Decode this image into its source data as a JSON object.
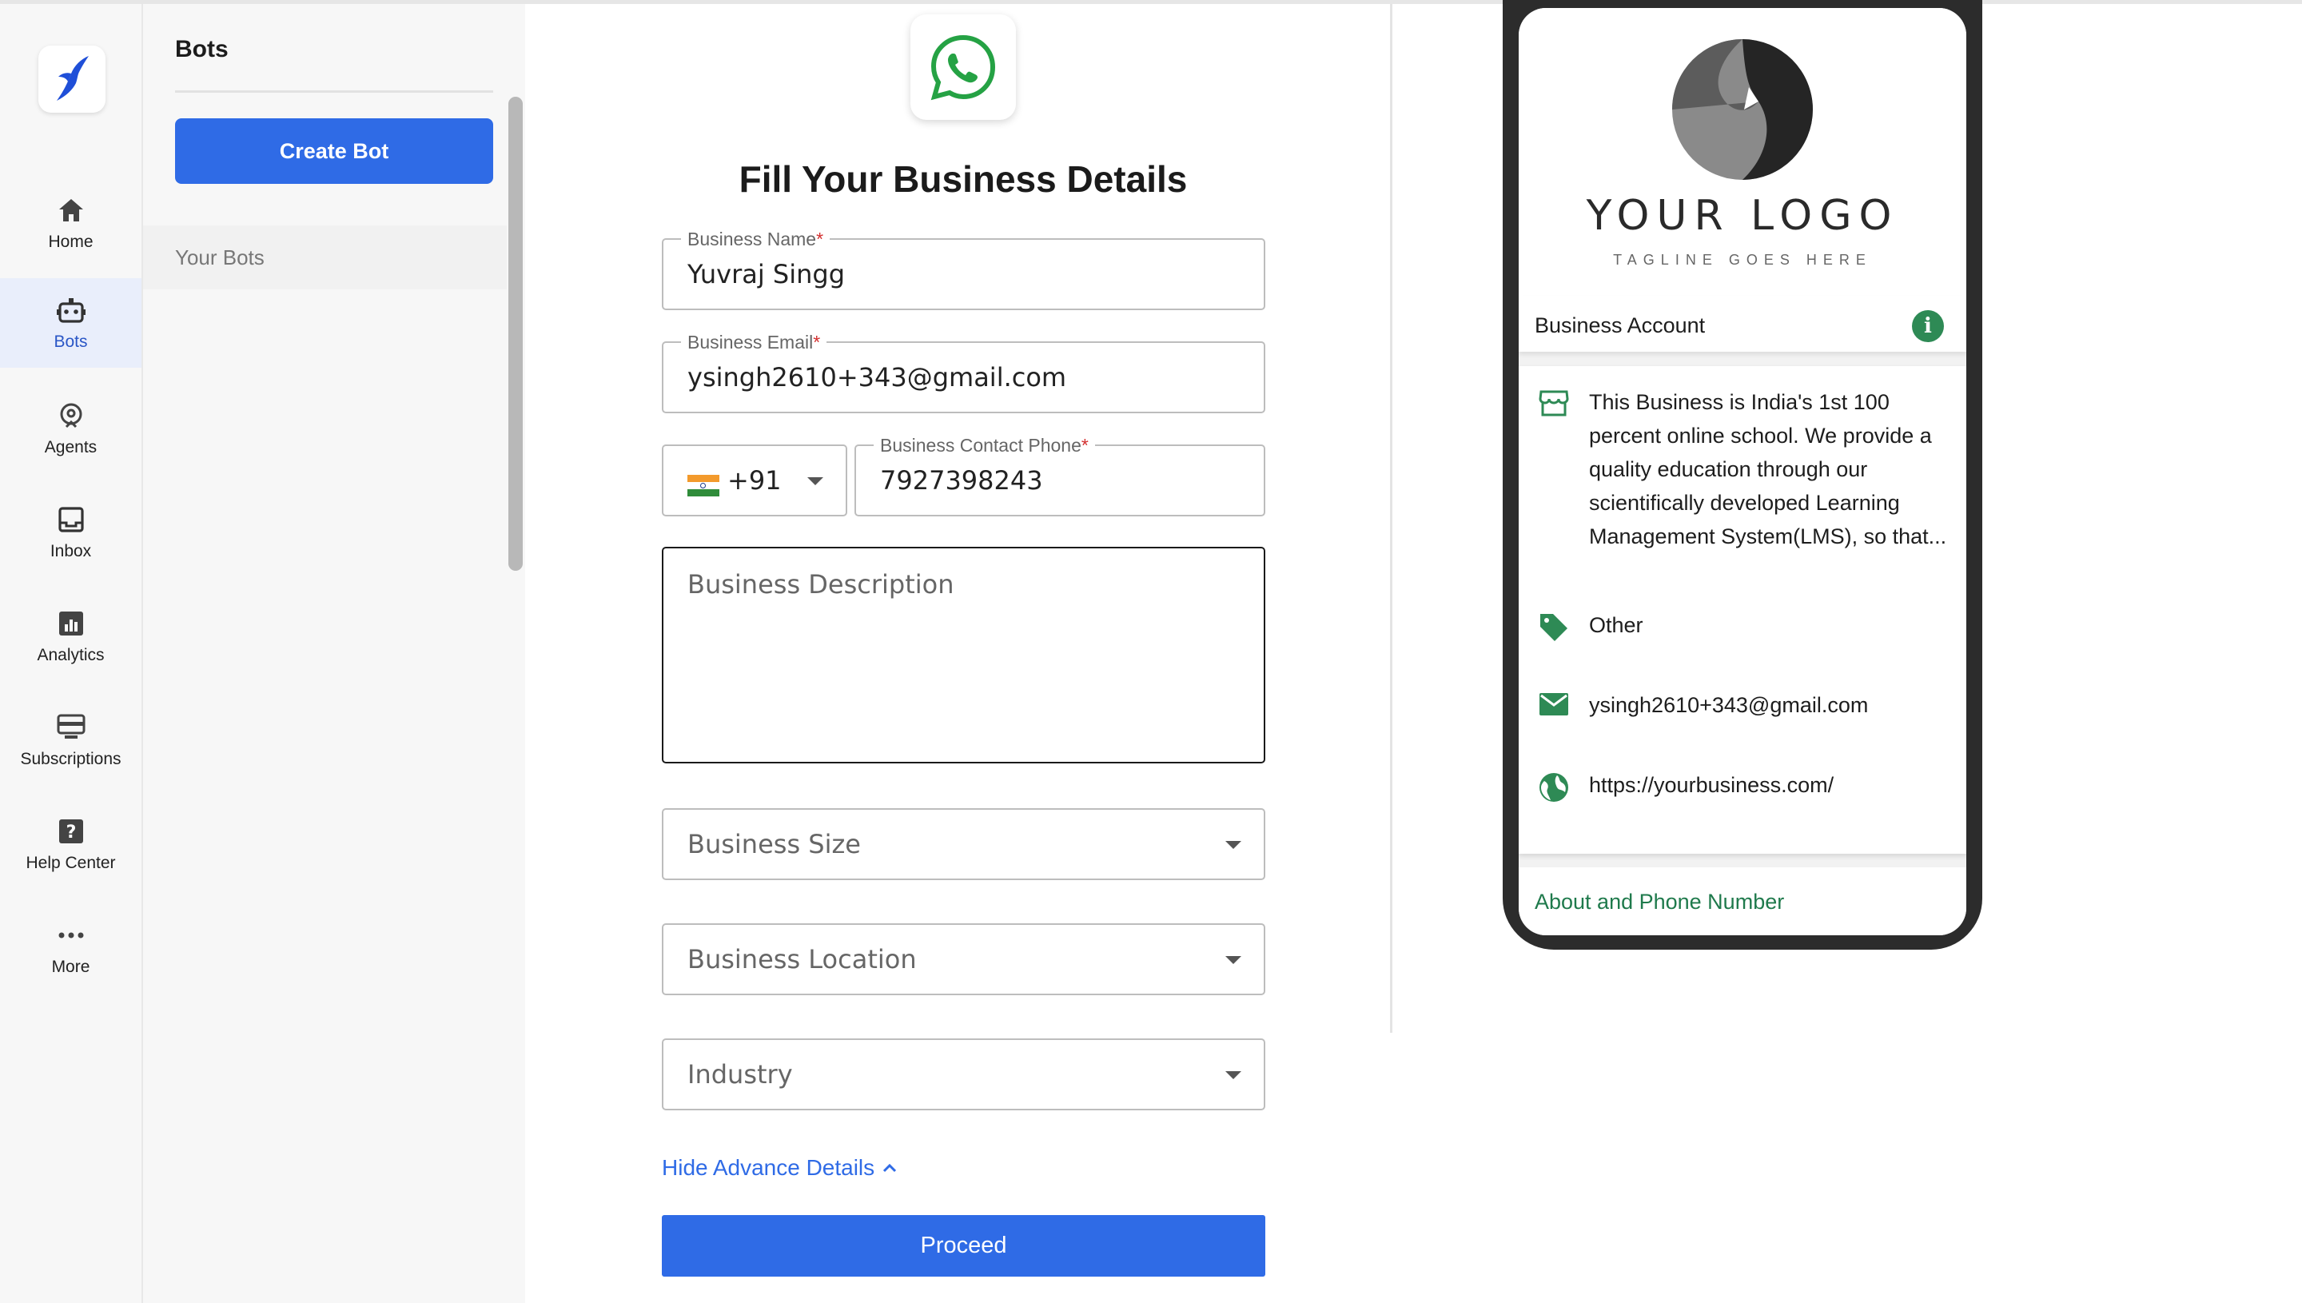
{
  "rail": {
    "items": [
      {
        "label": "Home",
        "icon": "home-icon"
      },
      {
        "label": "Bots",
        "icon": "bot-icon",
        "active": true
      },
      {
        "label": "Agents",
        "icon": "agent-icon"
      },
      {
        "label": "Inbox",
        "icon": "inbox-icon"
      },
      {
        "label": "Analytics",
        "icon": "analytics-icon"
      },
      {
        "label": "Subscriptions",
        "icon": "subscriptions-icon"
      },
      {
        "label": "Help Center",
        "icon": "help-icon"
      },
      {
        "label": "More",
        "icon": "more-icon"
      }
    ]
  },
  "bots": {
    "title": "Bots",
    "create_label": "Create Bot",
    "your_bots_label": "Your Bots"
  },
  "form": {
    "title": "Fill Your Business Details",
    "business_name": {
      "label": "Business Name",
      "required": "*",
      "value": "Yuvraj Singg"
    },
    "business_email": {
      "label": "Business Email",
      "required": "*",
      "value": "ysingh2610+343@gmail.com"
    },
    "country_code": {
      "value": "+91",
      "flag": "india-flag"
    },
    "phone": {
      "label": "Business Contact Phone",
      "required": "*",
      "value": "7927398243"
    },
    "description": {
      "placeholder": "Business Description"
    },
    "size": {
      "placeholder": "Business Size"
    },
    "location": {
      "placeholder": "Business Location"
    },
    "industry": {
      "placeholder": "Industry"
    },
    "hide_advanced_label": "Hide Advance Details",
    "proceed_label": "Proceed"
  },
  "preview": {
    "logo_text": "YOUR LOGO",
    "logo_tagline": "TAGLINE GOES HERE",
    "account_label": "Business Account",
    "description": "This Business is India's 1st 100 percent online school. We provide a quality education through our scientifically developed Learning Management System(LMS), so that...",
    "category": "Other",
    "email": "ysingh2610+343@gmail.com",
    "website": "https://yourbusiness.com/",
    "about_label": "About and Phone Number"
  },
  "colors": {
    "primary": "#2f6be6",
    "whatsapp_green": "#25a244",
    "preview_green": "#2e8a55",
    "required": "#d32f2f"
  }
}
